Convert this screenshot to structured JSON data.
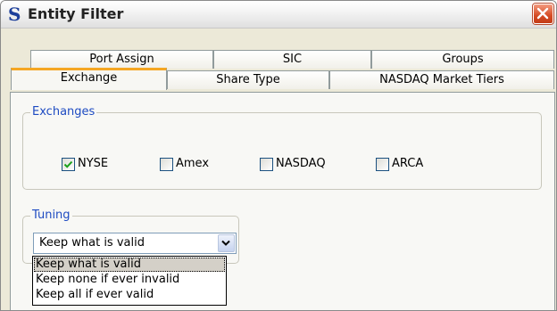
{
  "window": {
    "title": "Entity Filter",
    "app_icon_glyph": "S"
  },
  "tabs_back": [
    "Port Assign",
    "SIC",
    "Groups"
  ],
  "tabs_front": [
    "Exchange",
    "Share Type",
    "NASDAQ Market Tiers"
  ],
  "active_tab": "Exchange",
  "exchanges": {
    "label": "Exchanges",
    "items": [
      {
        "label": "NYSE",
        "checked": true
      },
      {
        "label": "Amex",
        "checked": false
      },
      {
        "label": "NASDAQ",
        "checked": false
      },
      {
        "label": "ARCA",
        "checked": false
      }
    ]
  },
  "tuning": {
    "label": "Tuning",
    "selected": "Keep what is valid",
    "options": [
      "Keep what is valid",
      "Keep none if ever invalid",
      "Keep all if ever valid"
    ]
  },
  "colors": {
    "accent_tab": "#f5a623",
    "group_label": "#1e4bc2",
    "close_button": "#d54b24",
    "checkmark": "#1aa01a"
  }
}
